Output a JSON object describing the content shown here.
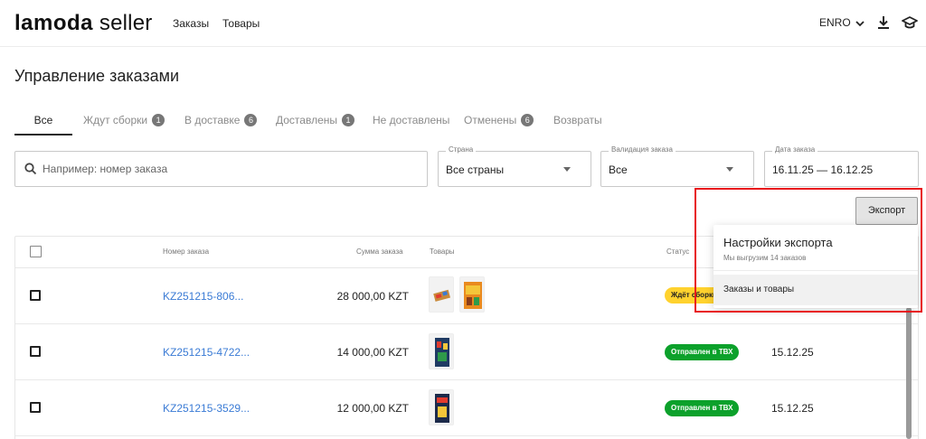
{
  "header": {
    "logo_brand": "lamoda",
    "logo_suffix": "seller",
    "nav": [
      "Заказы",
      "Товары"
    ],
    "language": "ENRO"
  },
  "page": {
    "title": "Управление заказами"
  },
  "tabs": [
    {
      "label": "Все",
      "badge": null
    },
    {
      "label": "Ждут сборки",
      "badge": "1"
    },
    {
      "label": "В доставке",
      "badge": "6"
    },
    {
      "label": "Доставлены",
      "badge": "1"
    },
    {
      "label": "Не доставлены",
      "badge": null
    },
    {
      "label": "Отменены",
      "badge": "6"
    },
    {
      "label": "Возвраты",
      "badge": null
    }
  ],
  "filters": {
    "search_placeholder": "Например: номер заказа",
    "country": {
      "label": "Страна",
      "value": "Все страны"
    },
    "validation": {
      "label": "Валидация заказа",
      "value": "Все"
    },
    "date": {
      "label": "Дата заказа",
      "value": "16.11.25 — 16.12.25"
    }
  },
  "export": {
    "button_label": "Экспорт",
    "dropdown": {
      "title": "Настройки экспорта",
      "subtitle": "Мы выгрузим 14 заказов",
      "option": "Заказы и товары"
    }
  },
  "table": {
    "columns": {
      "order": "Номер заказа",
      "sum": "Сумма заказа",
      "goods": "Товары",
      "status": "Статус"
    },
    "rows": [
      {
        "order": "KZ251215-806...",
        "sum": "28 000,00 KZT",
        "status": "Ждёт сборки",
        "status_color": "#ffd22e",
        "date": ""
      },
      {
        "order": "KZ251215-4722...",
        "sum": "14 000,00 KZT",
        "status": "Отправлен в ТВХ",
        "status_color": "#0ca12b",
        "date": "15.12.25"
      },
      {
        "order": "KZ251215-3529...",
        "sum": "12 000,00 KZT",
        "status": "Отправлен в ТВХ",
        "status_color": "#0ca12b",
        "date": "15.12.25"
      }
    ]
  },
  "colors": {
    "link": "#3a7bd5",
    "status_green": "#0ca12b",
    "status_yellow": "#ffd22e",
    "highlight": "#e8151c"
  },
  "icons": [
    "search-icon",
    "download-icon",
    "graduation-cap-icon",
    "chevron-down-icon"
  ]
}
